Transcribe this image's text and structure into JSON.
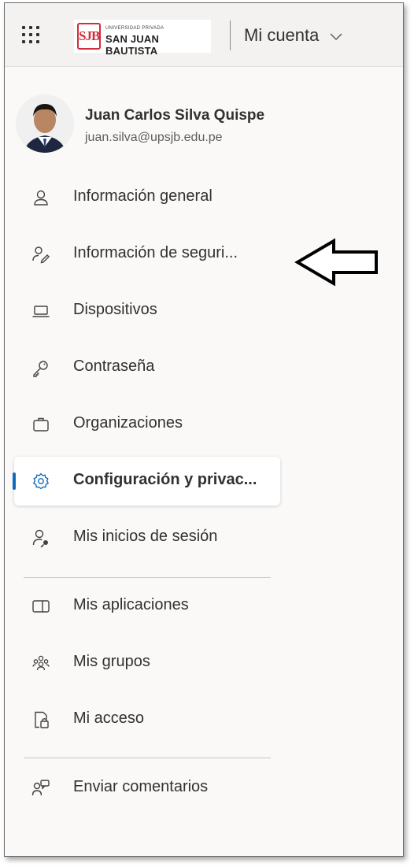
{
  "header": {
    "menu_icon": "waffle-icon",
    "logo": {
      "mark_text": "SJB",
      "small_text": "UNIVERSIDAD PRIVADA",
      "big_text": "SAN JUAN BAUTISTA"
    },
    "account_label": "Mi cuenta",
    "account_chevron": "chevron-down-icon"
  },
  "profile": {
    "name": "Juan Carlos Silva Quispe",
    "email": "juan.silva@upsjb.edu.pe"
  },
  "nav": {
    "items": [
      {
        "label": "Información general",
        "icon": "person-icon"
      },
      {
        "label": "Información de seguri...",
        "icon": "person-key-icon"
      },
      {
        "label": "Dispositivos",
        "icon": "laptop-icon"
      },
      {
        "label": "Contraseña",
        "icon": "key-icon"
      },
      {
        "label": "Organizaciones",
        "icon": "briefcase-icon"
      },
      {
        "label": "Configuración y privac...",
        "icon": "gear-icon",
        "active": true
      },
      {
        "label": "Mis inicios de sesión",
        "icon": "person-signin-icon"
      }
    ],
    "apps": [
      {
        "label": "Mis aplicaciones",
        "icon": "apps-icon"
      },
      {
        "label": "Mis grupos",
        "icon": "people-group-icon"
      },
      {
        "label": "Mi acceso",
        "icon": "access-lock-icon"
      }
    ],
    "feedback": {
      "label": "Enviar comentarios",
      "icon": "feedback-icon"
    }
  },
  "annotation": {
    "icon": "left-arrow-icon"
  },
  "colors": {
    "accent": "#0f6cbd",
    "header_bg": "#f3f2f1",
    "panel_bg": "#faf9f8"
  }
}
